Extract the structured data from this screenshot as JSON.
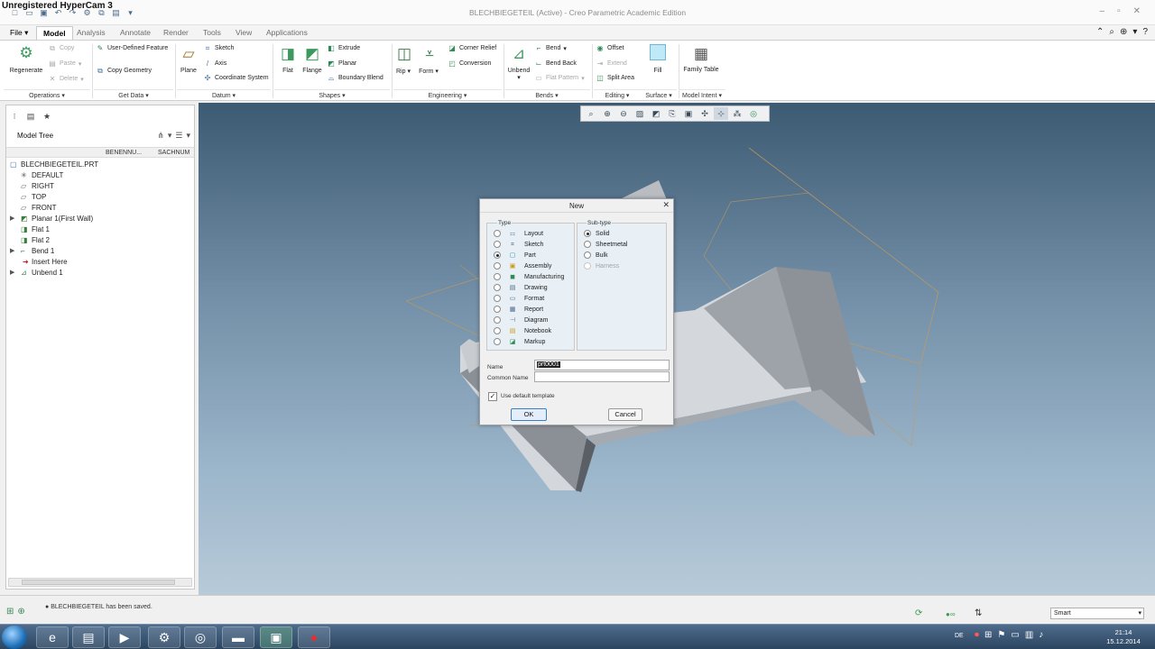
{
  "app": {
    "watermark": "Unregistered HyperCam 3",
    "window_title": "BLECHBIEGETEIL (Active) - Creo Parametric Academic Edition"
  },
  "quick_access": [
    "new-icon",
    "open-icon",
    "save-icon",
    "undo-icon",
    "redo-icon",
    "regenerate-icon",
    "windows-icon",
    "close-icon",
    "customize-icon"
  ],
  "tabs": [
    {
      "label": "File",
      "active": false
    },
    {
      "label": "Model",
      "active": true
    },
    {
      "label": "Analysis",
      "active": false
    },
    {
      "label": "Annotate",
      "active": false
    },
    {
      "label": "Render",
      "active": false
    },
    {
      "label": "Tools",
      "active": false
    },
    {
      "label": "View",
      "active": false
    },
    {
      "label": "Applications",
      "active": false
    }
  ],
  "ribbon": {
    "operations": {
      "regenerate": "Regenerate",
      "copy": "Copy",
      "paste": "Paste",
      "delete": "Delete",
      "group": "Operations"
    },
    "get_data": {
      "udf": "User-Defined Feature",
      "copy_geometry": "Copy Geometry",
      "group": "Get Data"
    },
    "datum": {
      "plane": "Plane",
      "sketch": "Sketch",
      "axis": "Axis",
      "csys": "Coordinate System",
      "group": "Datum"
    },
    "shapes": {
      "flat": "Flat",
      "flange": "Flange",
      "extrude": "Extrude",
      "planar": "Planar",
      "boundary_blend": "Boundary Blend",
      "group": "Shapes"
    },
    "engineering": {
      "rip": "Rip",
      "form": "Form",
      "corner_relief": "Corner Relief",
      "conversion": "Conversion",
      "group": "Engineering"
    },
    "bends": {
      "unbend": "Unbend",
      "bend": "Bend",
      "bend_back": "Bend Back",
      "flat_pattern": "Flat Pattern",
      "group": "Bends"
    },
    "editing": {
      "offset": "Offset",
      "extend": "Extend",
      "split_area": "Split Area",
      "fill": "Fill",
      "group": "Editing"
    },
    "surface": {
      "group": "Surface"
    },
    "model_intent": {
      "family_table": "Family Table",
      "group": "Model Intent"
    }
  },
  "model_tree": {
    "title": "Model Tree",
    "columns": [
      "BENENNU...",
      "SACHNUM"
    ],
    "items": [
      {
        "label": "BLECHBIEGETEIL.PRT",
        "icon": "part-icon",
        "expand": false
      },
      {
        "label": "DEFAULT",
        "icon": "csys-icon",
        "expand": false
      },
      {
        "label": "RIGHT",
        "icon": "datum-plane-icon",
        "expand": false
      },
      {
        "label": "TOP",
        "icon": "datum-plane-icon",
        "expand": false
      },
      {
        "label": "FRONT",
        "icon": "datum-plane-icon",
        "expand": false
      },
      {
        "label": "Planar 1(First Wall)",
        "icon": "planar-wall-icon",
        "expand": true
      },
      {
        "label": "Flat 1",
        "icon": "flat-wall-icon",
        "expand": false
      },
      {
        "label": "Flat 2",
        "icon": "flat-wall-icon",
        "expand": false
      },
      {
        "label": "Bend 1",
        "icon": "bend-icon",
        "expand": true
      },
      {
        "label": "Insert Here",
        "icon": "insert-here-icon",
        "expand": false
      },
      {
        "label": "Unbend 1",
        "icon": "unbend-icon",
        "expand": true
      }
    ]
  },
  "dialog": {
    "title": "New",
    "type_label": "Type",
    "subtype_label": "Sub-type",
    "types": [
      {
        "label": "Layout",
        "icon": "layout-icon",
        "selected": false
      },
      {
        "label": "Sketch",
        "icon": "sketch-icon",
        "selected": false
      },
      {
        "label": "Part",
        "icon": "part-icon",
        "selected": true
      },
      {
        "label": "Assembly",
        "icon": "assembly-icon",
        "selected": false
      },
      {
        "label": "Manufacturing",
        "icon": "manufacturing-icon",
        "selected": false
      },
      {
        "label": "Drawing",
        "icon": "drawing-icon",
        "selected": false
      },
      {
        "label": "Format",
        "icon": "format-icon",
        "selected": false
      },
      {
        "label": "Report",
        "icon": "report-icon",
        "selected": false
      },
      {
        "label": "Diagram",
        "icon": "diagram-icon",
        "selected": false
      },
      {
        "label": "Notebook",
        "icon": "notebook-icon",
        "selected": false
      },
      {
        "label": "Markup",
        "icon": "markup-icon",
        "selected": false
      }
    ],
    "subtypes": [
      {
        "label": "Solid",
        "selected": true,
        "enabled": true
      },
      {
        "label": "Sheetmetal",
        "selected": false,
        "enabled": true
      },
      {
        "label": "Bulk",
        "selected": false,
        "enabled": true
      },
      {
        "label": "Harness",
        "selected": false,
        "enabled": false
      }
    ],
    "name_label": "Name",
    "name_value": "prt0001",
    "common_name_label": "Common Name",
    "common_name_value": "",
    "use_default_template": "Use default template",
    "ok": "OK",
    "cancel": "Cancel"
  },
  "status": {
    "message": "BLECHBIEGETEIL has been saved.",
    "filter": "Smart"
  },
  "taskbar": {
    "language": "DE",
    "time": "21:14",
    "date": "15.12.2014"
  }
}
